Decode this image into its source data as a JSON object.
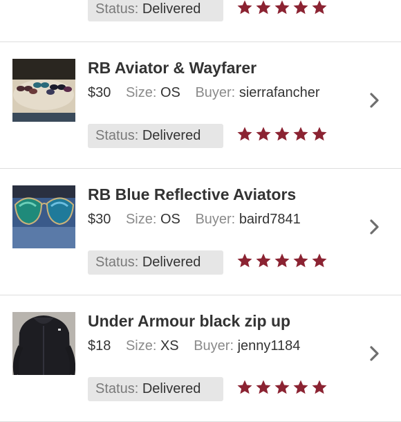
{
  "labels": {
    "size": "Size:",
    "buyer": "Buyer:",
    "status": "Status:"
  },
  "star_color": "#8b2332",
  "items": [
    {
      "title": "",
      "price": "",
      "size": "",
      "buyer": "",
      "status": "Delivered",
      "rating": 5,
      "icon": "partial-listing"
    },
    {
      "title": "RB Aviator & Wayfarer",
      "price": "$30",
      "size": "OS",
      "buyer": "sierrafancher",
      "status": "Delivered",
      "rating": 5,
      "icon": "sunglasses-photo"
    },
    {
      "title": "RB Blue Reflective Aviators",
      "price": "$30",
      "size": "OS",
      "buyer": "baird7841",
      "status": "Delivered",
      "rating": 5,
      "icon": "aviators-photo"
    },
    {
      "title": "Under Armour black zip up",
      "price": "$18",
      "size": "XS",
      "buyer": "jenny1184",
      "status": "Delivered",
      "rating": 5,
      "icon": "hoodie-photo"
    }
  ]
}
